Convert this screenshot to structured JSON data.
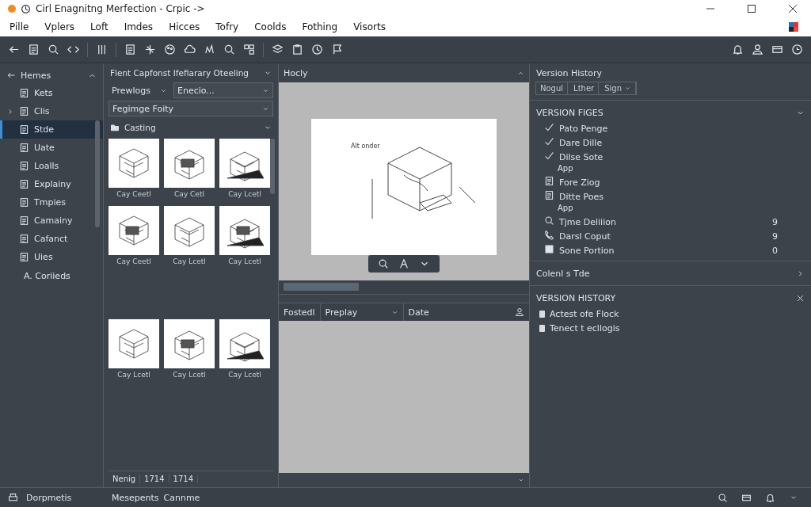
{
  "window": {
    "title": "Cirl Enagnitng Merfection - Crpic ->"
  },
  "menu": [
    "Pille",
    "Vplers",
    "Loft",
    "Imdes",
    "Hicces",
    "Tofry",
    "Coolds",
    "Fothing",
    "Visorts"
  ],
  "sidebar": {
    "title": "Hemes",
    "items": [
      {
        "label": "Kets",
        "selected": false,
        "expandable": false
      },
      {
        "label": "Clis",
        "selected": false,
        "expandable": true
      },
      {
        "label": "Stde",
        "selected": true,
        "expandable": false
      },
      {
        "label": "Uate",
        "selected": false,
        "expandable": false
      },
      {
        "label": "Loalls",
        "selected": false,
        "expandable": false
      },
      {
        "label": "Explainy",
        "selected": false,
        "expandable": false
      },
      {
        "label": "Tmpies",
        "selected": false,
        "expandable": false
      },
      {
        "label": "Camainy",
        "selected": false,
        "expandable": false
      },
      {
        "label": "Cafanct",
        "selected": false,
        "expandable": false
      },
      {
        "label": "Uies",
        "selected": false,
        "expandable": false
      }
    ],
    "footer": "A. Coriieds"
  },
  "gallery": {
    "title": "Flent Capfonst Ifefiarary Oteeling",
    "filter": "Prewlogs",
    "search": {
      "value": "Enecio..."
    },
    "sort": "Fegimge Foity",
    "section": "Casting",
    "items": [
      {
        "caption": "Cay Ceetl"
      },
      {
        "caption": "Cay Cetl"
      },
      {
        "caption": "Cay Lcetl"
      },
      {
        "caption": "Cay Ceetl"
      },
      {
        "caption": "Cay Lcetl"
      },
      {
        "caption": "Cay Lcetl"
      },
      {
        "caption": "Cay Lcetl"
      },
      {
        "caption": "Cay Lcetl"
      },
      {
        "caption": "Cay Lcetl"
      }
    ],
    "footer": [
      "Nenig",
      "1714",
      "1714"
    ]
  },
  "preview": {
    "title": "Hocly",
    "drawing_label": "Alt onder",
    "table_columns": [
      "Fostedl",
      "Preplay",
      "Date"
    ]
  },
  "inspector": {
    "title": "Version History",
    "tabs": [
      "Nogul",
      "Lther",
      "Sign"
    ],
    "sections": [
      {
        "title": "VERSION FIGES",
        "expanded": true,
        "items": [
          {
            "kind": "check",
            "label": "Pato Penge"
          },
          {
            "kind": "check",
            "label": "Dare Dille"
          },
          {
            "kind": "check",
            "label": "Dilse Sote",
            "sub": "App"
          },
          {
            "kind": "doc",
            "label": "Fore Ziog"
          },
          {
            "kind": "doc",
            "label": "Ditte Poes",
            "sub": "App"
          },
          {
            "kind": "search",
            "label": "Tjme Deliiion",
            "count": "9"
          },
          {
            "kind": "phone",
            "label": "Darsl Coput",
            "count": "9"
          },
          {
            "kind": "square",
            "label": "Sone Portion",
            "count": "0"
          }
        ]
      },
      {
        "title": "Colenl s Tde",
        "expanded": false
      }
    ],
    "history": {
      "title": "VERSION HISTORY",
      "items": [
        "Actest ofe Flock",
        "Tenect t ecllogis"
      ]
    }
  },
  "status_bar": {
    "left": "Dorpmetis",
    "middle": [
      "Mesepents",
      "Cannme"
    ]
  }
}
